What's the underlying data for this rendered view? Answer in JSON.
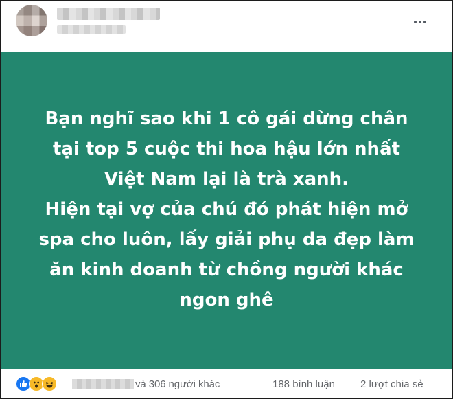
{
  "post": {
    "more_icon": "more-horizontal-icon",
    "text": "Bạn nghĩ sao khi 1 cô gái dừng chân\ntại top 5 cuộc thi hoa hậu lớn nhất\nViệt Nam lại là trà xanh.\nHiện tại vợ của chú đó phát hiện mở\nspa cho luôn, lấy giải phụ da đẹp làm\năn kinh doanh từ chồng người khác\nngon ghê",
    "background_color": "#23876f",
    "text_color": "#ffffff"
  },
  "footer": {
    "reaction_icons": [
      "like-icon",
      "wow-icon",
      "haha-icon"
    ],
    "others_text": "và 306 người khác",
    "comments_text": "188 bình luận",
    "shares_text": "2 lượt chia sẻ"
  }
}
